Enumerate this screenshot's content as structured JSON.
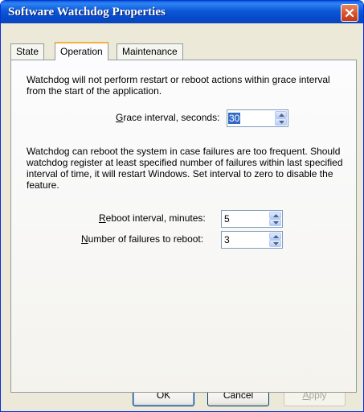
{
  "window": {
    "title": "Software Watchdog Properties"
  },
  "tabs": [
    {
      "label": "State"
    },
    {
      "label": "Operation"
    },
    {
      "label": "Maintenance"
    }
  ],
  "operation": {
    "grace_description": "Watchdog will not perform restart or reboot actions within grace interval from the start of the application.",
    "grace_label": "Grace interval, seconds:",
    "grace_value": "30",
    "reboot_description": "Watchdog can reboot the system in case failures are too frequent. Should watchdog register at least specified number of failures within last specified interval of time, it will restart Windows. Set interval to zero to disable the feature.",
    "reboot_interval_label": "Reboot interval, minutes:",
    "reboot_interval_value": "5",
    "failures_label": "Number of failures to reboot:",
    "failures_value": "3"
  },
  "buttons": {
    "ok": "OK",
    "cancel": "Cancel",
    "apply": "Apply"
  },
  "icons": {
    "close": "close-icon",
    "spin_up": "chevron-up-icon",
    "spin_down": "chevron-down-icon"
  },
  "colors": {
    "titlebar": "#0a5fd8",
    "close": "#d4502c",
    "selection": "#316ac5",
    "active_tab_accent": "#f3b23c"
  }
}
